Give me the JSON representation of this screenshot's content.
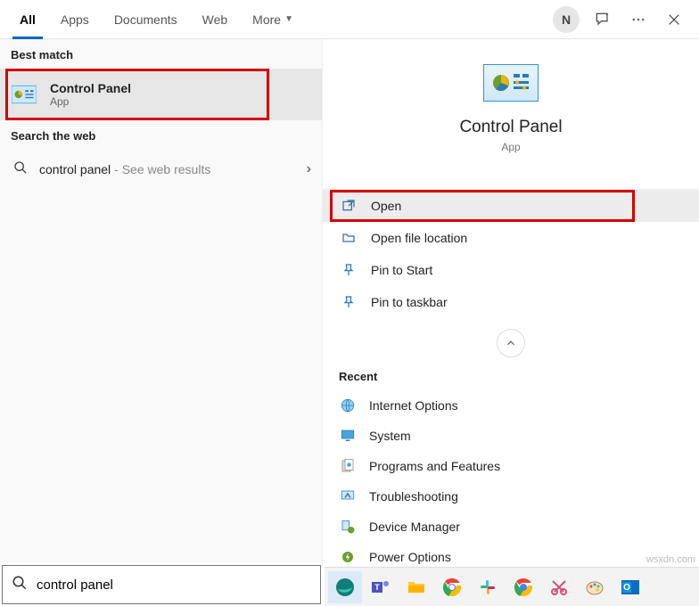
{
  "tabs": {
    "all": "All",
    "apps": "Apps",
    "documents": "Documents",
    "web": "Web",
    "more": "More"
  },
  "avatar_initial": "N",
  "left": {
    "best_match_header": "Best match",
    "best_match_title": "Control Panel",
    "best_match_sub": "App",
    "search_web_header": "Search the web",
    "web_query": "control panel",
    "web_hint": " - See web results"
  },
  "preview": {
    "title": "Control Panel",
    "sub": "App"
  },
  "actions": {
    "open": "Open",
    "open_file_location": "Open file location",
    "pin_start": "Pin to Start",
    "pin_taskbar": "Pin to taskbar"
  },
  "recent": {
    "header": "Recent",
    "items": [
      "Internet Options",
      "System",
      "Programs and Features",
      "Troubleshooting",
      "Device Manager",
      "Power Options"
    ]
  },
  "search": {
    "value": "control panel"
  },
  "watermark": "wsxdn.com"
}
